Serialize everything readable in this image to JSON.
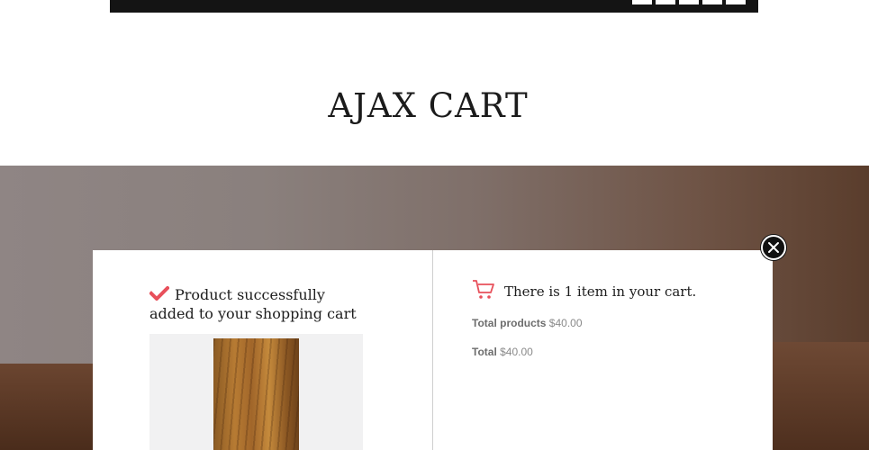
{
  "header": {
    "title": "AJAX CART"
  },
  "modal": {
    "success_message": "Product successfully added to your shopping cart",
    "cart_message": "There is 1 item in your cart.",
    "total_products_label": "Total products",
    "total_products_value": "$40.00",
    "total_label": "Total",
    "total_value": "$40.00",
    "product_image_alt": "wood plank"
  },
  "icons": {
    "check": "check-icon",
    "cart": "cart-icon",
    "close": "close-icon"
  },
  "colors": {
    "accent": "#e8505b",
    "topbar": "#141414",
    "text": "#1d1d1d"
  }
}
